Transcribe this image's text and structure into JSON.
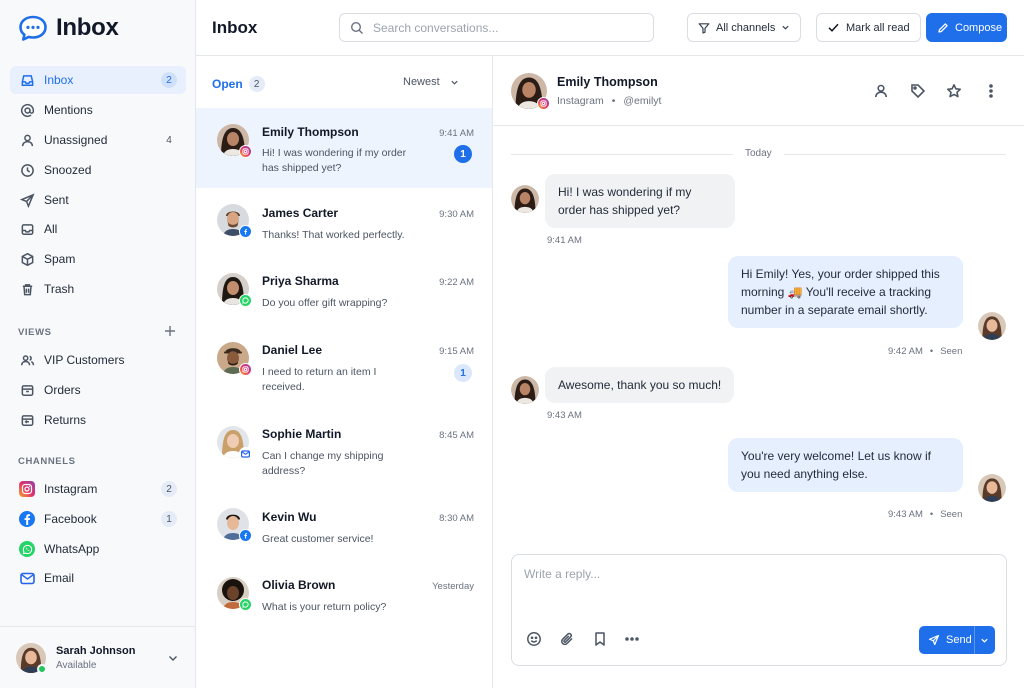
{
  "app": {
    "brand": "Inbox",
    "accent": "#1f6feb"
  },
  "sidebar": {
    "items": [
      {
        "label": "Inbox",
        "badge": "2",
        "icon": "inbox-icon",
        "active": true
      },
      {
        "label": "Mentions",
        "badge": "",
        "icon": "at-sign-icon"
      },
      {
        "label": "Unassigned",
        "badge": "4",
        "icon": "user-icon"
      },
      {
        "label": "Snoozed",
        "badge": "",
        "icon": "clock-icon"
      },
      {
        "label": "Sent",
        "badge": "",
        "icon": "send-icon"
      },
      {
        "label": "All",
        "badge": "",
        "icon": "inbox-tray-icon"
      },
      {
        "label": "Spam",
        "badge": "",
        "icon": "cube-icon"
      },
      {
        "label": "Trash",
        "badge": "",
        "icon": "trash-icon"
      }
    ],
    "views_heading": "VIEWS",
    "views": [
      {
        "label": "VIP Customers",
        "icon": "users-icon"
      },
      {
        "label": "Orders",
        "icon": "box-icon"
      },
      {
        "label": "Returns",
        "icon": "return-box-icon"
      }
    ],
    "channels_heading": "CHANNELS",
    "channels": [
      {
        "label": "Instagram",
        "badge": "2",
        "icon": "instagram-icon",
        "color": "#e1306c"
      },
      {
        "label": "Facebook",
        "badge": "1",
        "icon": "facebook-icon",
        "color": "#1877f2"
      },
      {
        "label": "WhatsApp",
        "badge": "",
        "icon": "whatsapp-icon",
        "color": "#25d366"
      },
      {
        "label": "Email",
        "badge": "",
        "icon": "email-icon",
        "color": "#2563eb"
      }
    ],
    "user": {
      "name": "Sarah Johnson",
      "status": "Available"
    }
  },
  "topbar": {
    "title": "Inbox",
    "search_placeholder": "Search conversations...",
    "filter_label": "All channels",
    "mark_read_label": "Mark all read",
    "compose_label": "Compose"
  },
  "list": {
    "tab_label": "Open",
    "tab_count": "2",
    "sort_label": "Newest",
    "conversations": [
      {
        "name": "Emily Thompson",
        "time": "9:41 AM",
        "preview": "Hi! I was wondering if my order has shipped yet?",
        "unread": "1",
        "channel": "instagram",
        "active": true
      },
      {
        "name": "James Carter",
        "time": "9:30 AM",
        "preview": "Thanks! That worked perfectly.",
        "unread": "",
        "channel": "facebook"
      },
      {
        "name": "Priya Sharma",
        "time": "9:22 AM",
        "preview": "Do you offer gift wrapping?",
        "unread": "",
        "channel": "whatsapp"
      },
      {
        "name": "Daniel Lee",
        "time": "9:15 AM",
        "preview": "I need to return an item I received.",
        "unread": "1",
        "channel": "instagram"
      },
      {
        "name": "Sophie Martin",
        "time": "8:45 AM",
        "preview": "Can I change my shipping address?",
        "unread": "",
        "channel": "email"
      },
      {
        "name": "Kevin Wu",
        "time": "8:30 AM",
        "preview": "Great customer service!",
        "unread": "",
        "channel": "facebook"
      },
      {
        "name": "Olivia Brown",
        "time": "Yesterday",
        "preview": "What is your return policy?",
        "unread": "",
        "channel": "whatsapp"
      }
    ]
  },
  "chat": {
    "contact_name": "Emily Thompson",
    "contact_channel": "Instagram",
    "contact_handle": "@emilyt",
    "separator": "•",
    "day_label": "Today",
    "messages": [
      {
        "dir": "in",
        "text": "Hi! I was wondering if my order has shipped yet?",
        "time": "9:41 AM",
        "seen": ""
      },
      {
        "dir": "out",
        "text": "Hi Emily! Yes, your order shipped this morning 🚚 You'll receive a tracking number in a separate email shortly.",
        "time": "9:42 AM",
        "seen": "Seen"
      },
      {
        "dir": "in",
        "text": "Awesome, thank you so much!",
        "time": "9:43 AM",
        "seen": ""
      },
      {
        "dir": "out",
        "text": "You're very welcome! Let us know if you need anything else.",
        "time": "9:43 AM",
        "seen": "Seen"
      }
    ],
    "composer_placeholder": "Write a reply...",
    "send_label": "Send"
  }
}
